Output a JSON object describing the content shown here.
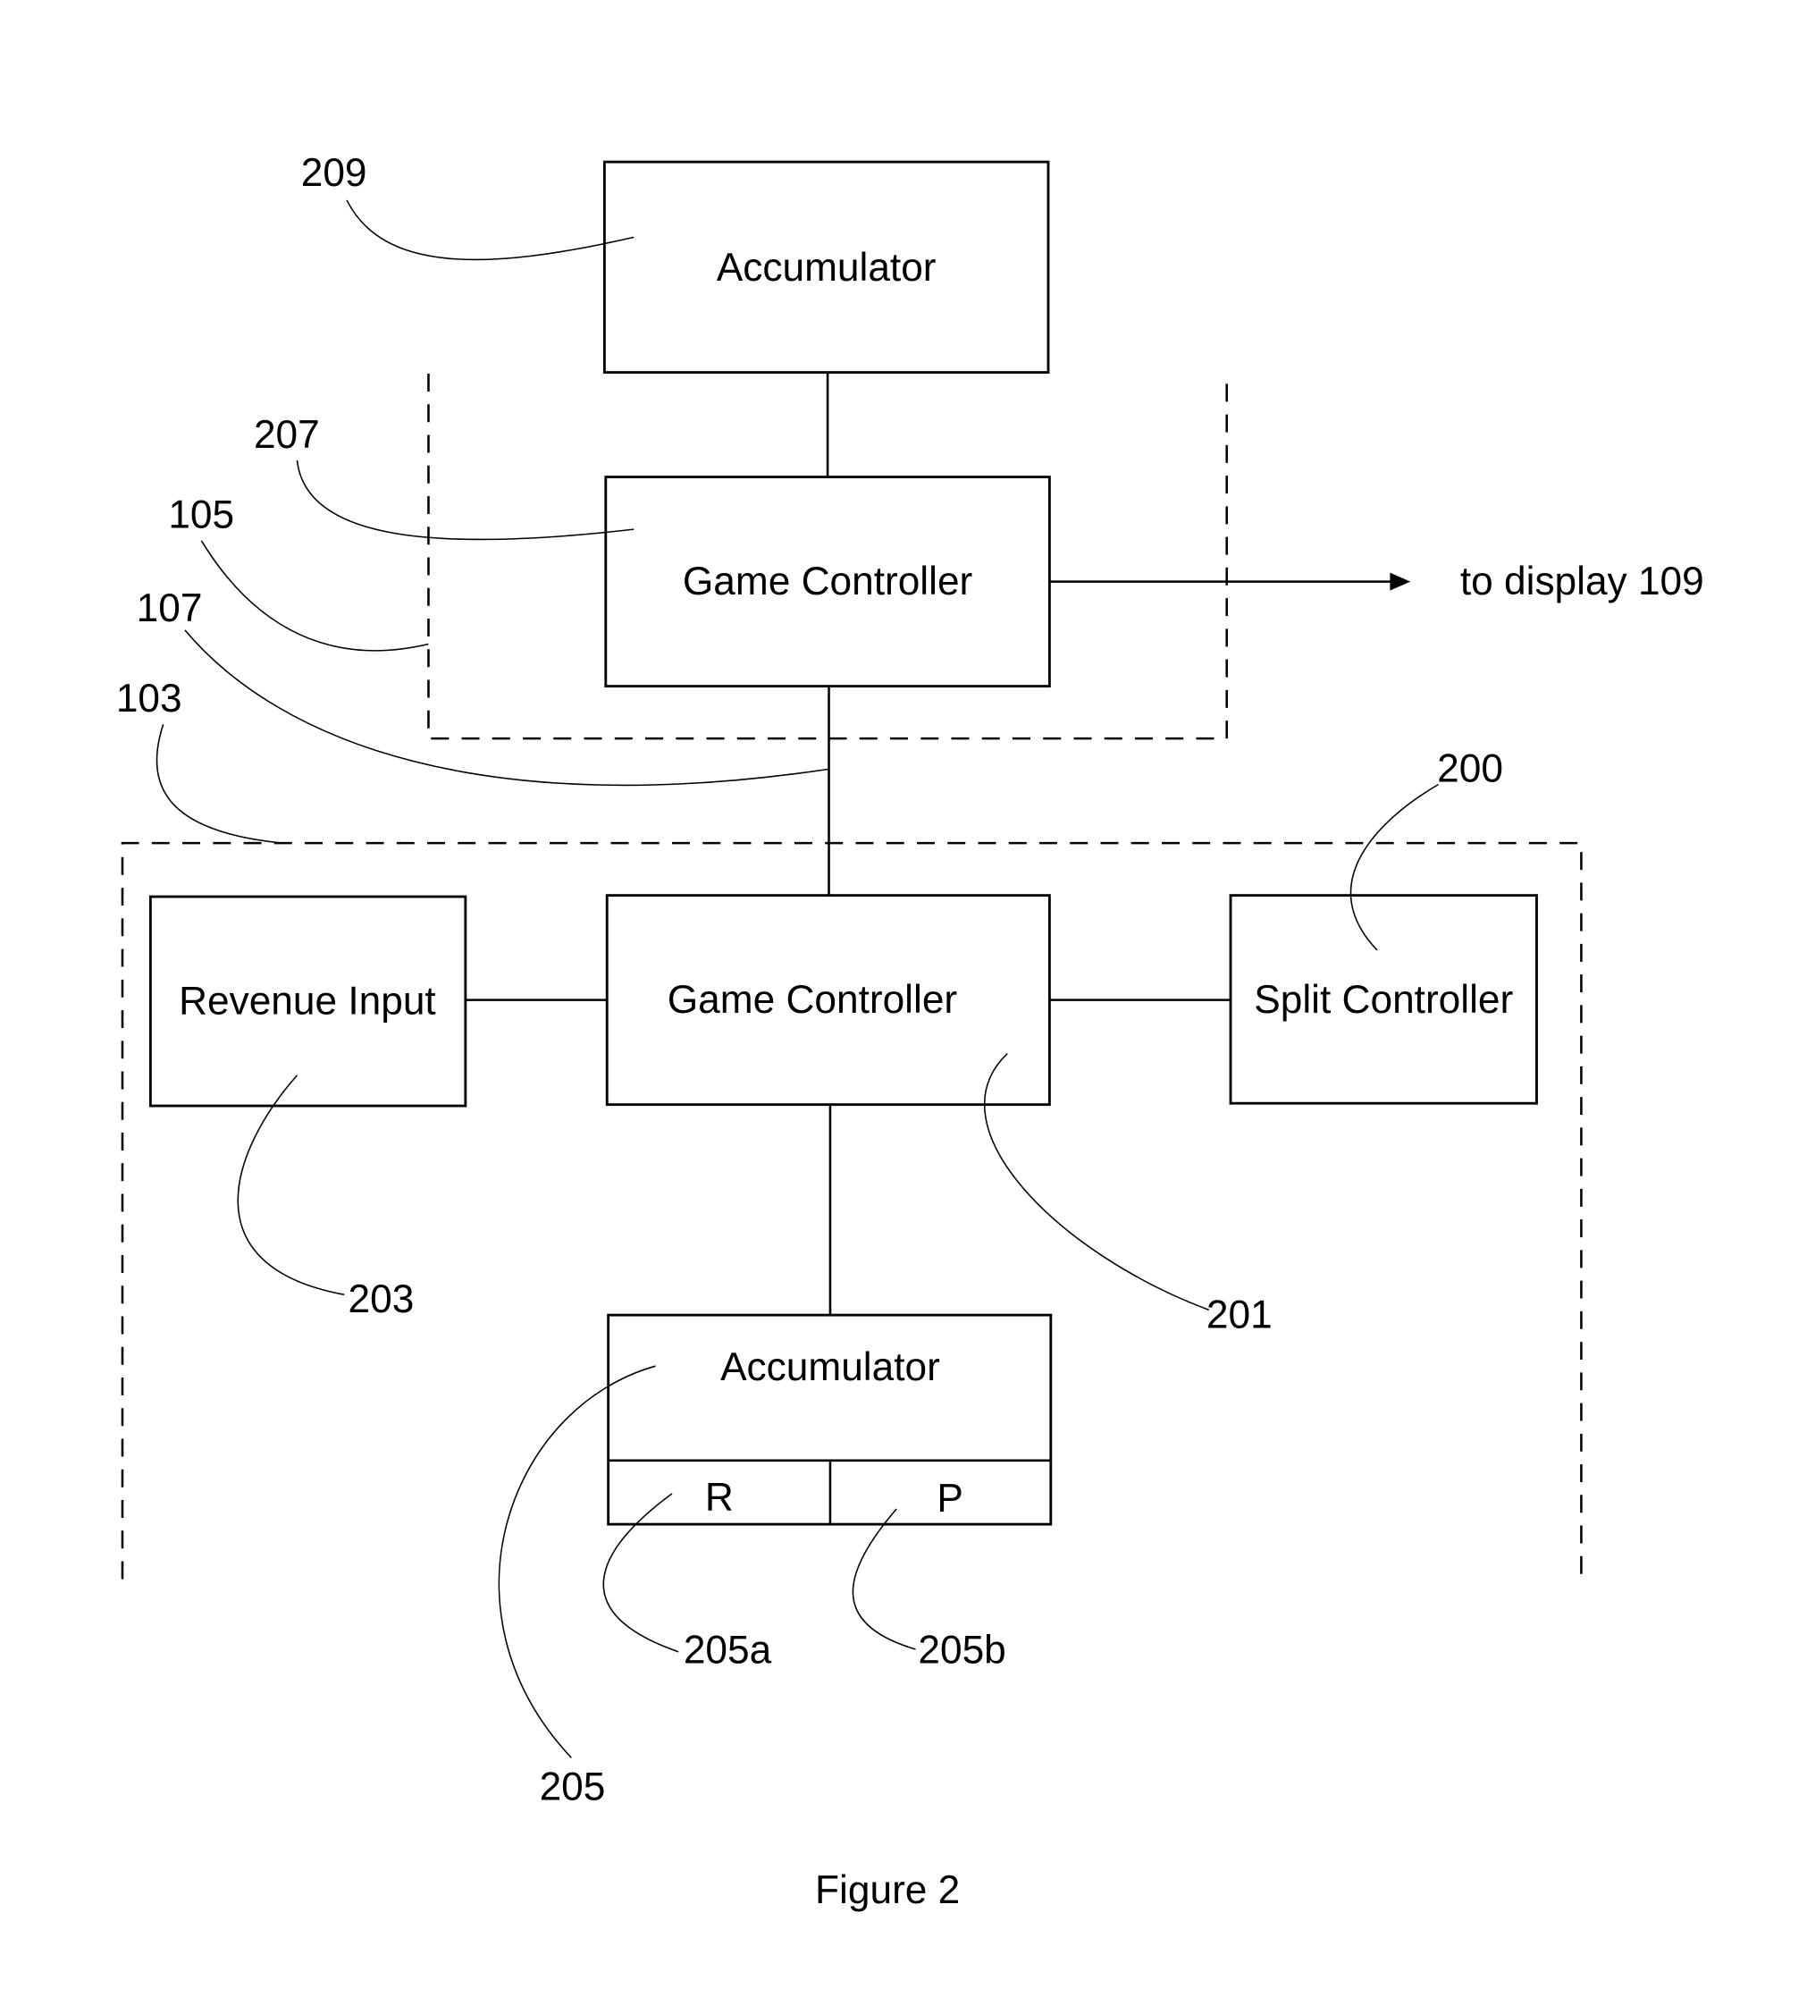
{
  "figure": {
    "caption": "Figure 2",
    "blocks": {
      "accumulator_top": {
        "label": "Accumulator",
        "ref": "209"
      },
      "game_controller_top": {
        "label": "Game Controller",
        "ref": "207"
      },
      "game_controller_main": {
        "label": "Game Controller",
        "ref": "201"
      },
      "revenue_input": {
        "label": "Revenue Input",
        "ref": "203"
      },
      "split_controller": {
        "label": "Split Controller",
        "ref": "200"
      },
      "accumulator_bottom": {
        "label": "Accumulator",
        "ref": "205",
        "sub_r": {
          "label": "R",
          "ref": "205a"
        },
        "sub_p": {
          "label": "P",
          "ref": "205b"
        }
      }
    },
    "regions": {
      "upper_dashed": {
        "ref": "105"
      },
      "lower_dashed": {
        "ref": "103"
      },
      "link": {
        "ref": "107"
      }
    },
    "output": {
      "label": "to display 109"
    }
  }
}
